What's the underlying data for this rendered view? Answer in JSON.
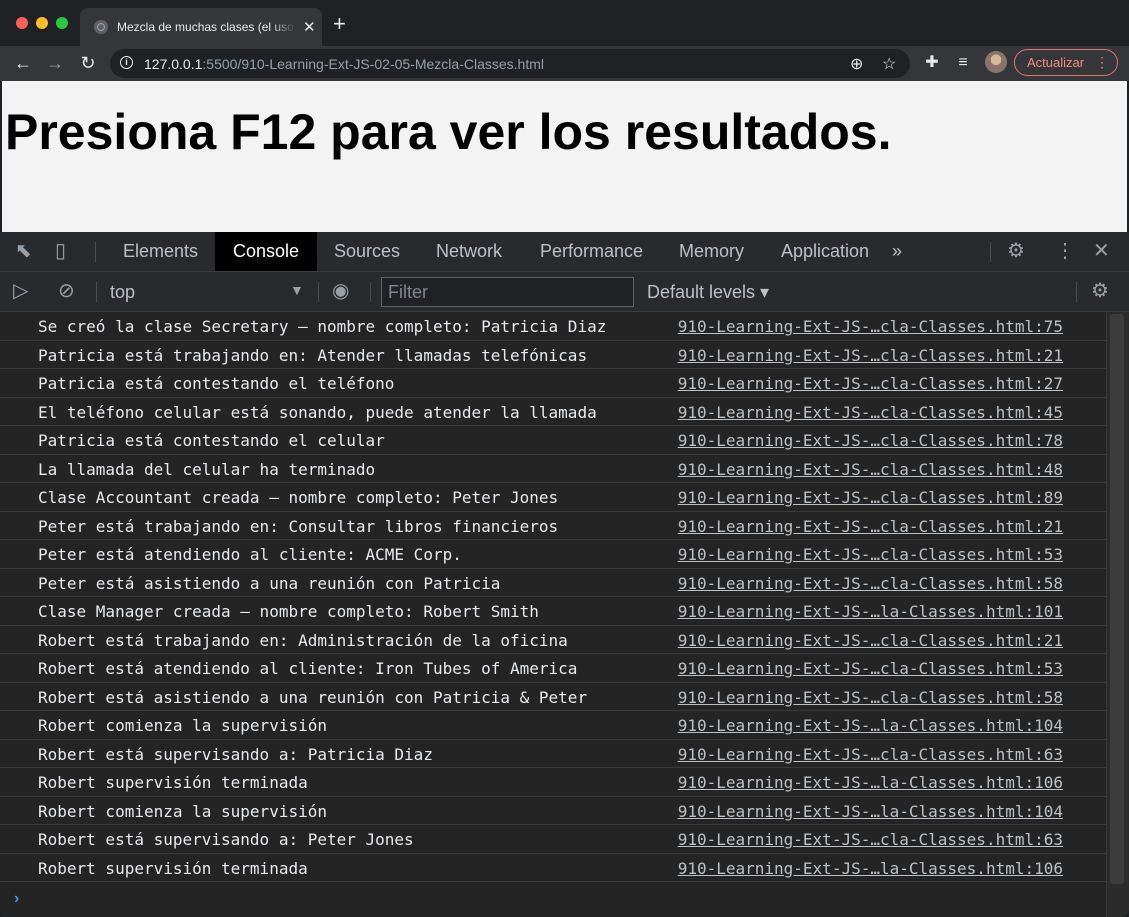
{
  "browser": {
    "tab_title": "Mezcla de muchas clases (el uso",
    "url_host": "127.0.0.1",
    "url_rest": ":5500/910-Learning-Ext-JS-02-05-Mezcla-Classes.html",
    "update_button": "Actualizar"
  },
  "page": {
    "heading": "Presiona F12 para ver los resultados."
  },
  "devtools": {
    "tabs": [
      "Elements",
      "Console",
      "Sources",
      "Network",
      "Performance",
      "Memory",
      "Application"
    ],
    "active_tab": "Console",
    "more_tabs": "»",
    "context": "top",
    "filter_placeholder": "Filter",
    "levels": "Default levels ▾"
  },
  "console_messages": [
    {
      "text": "Se creó la clase Secretary – nombre completo: Patricia Diaz",
      "source": "910-Learning-Ext-JS-…cla-Classes.html:75"
    },
    {
      "text": "Patricia está trabajando en: Atender llamadas telefónicas",
      "source": "910-Learning-Ext-JS-…cla-Classes.html:21"
    },
    {
      "text": "Patricia está contestando el teléfono",
      "source": "910-Learning-Ext-JS-…cla-Classes.html:27"
    },
    {
      "text": "El teléfono celular está sonando, puede atender la llamada",
      "source": "910-Learning-Ext-JS-…cla-Classes.html:45"
    },
    {
      "text": "Patricia está contestando el celular",
      "source": "910-Learning-Ext-JS-…cla-Classes.html:78"
    },
    {
      "text": "La llamada del celular ha terminado",
      "source": "910-Learning-Ext-JS-…cla-Classes.html:48"
    },
    {
      "text": "Clase Accountant creada – nombre completo: Peter Jones",
      "source": "910-Learning-Ext-JS-…cla-Classes.html:89"
    },
    {
      "text": "Peter está trabajando en: Consultar libros financieros",
      "source": "910-Learning-Ext-JS-…cla-Classes.html:21"
    },
    {
      "text": "Peter está atendiendo al cliente: ACME Corp.",
      "source": "910-Learning-Ext-JS-…cla-Classes.html:53"
    },
    {
      "text": "Peter está asistiendo a una reunión con Patricia",
      "source": "910-Learning-Ext-JS-…cla-Classes.html:58"
    },
    {
      "text": "Clase Manager creada – nombre completo: Robert Smith",
      "source": "910-Learning-Ext-JS-…la-Classes.html:101"
    },
    {
      "text": "Robert está trabajando en: Administración de la oficina",
      "source": "910-Learning-Ext-JS-…cla-Classes.html:21"
    },
    {
      "text": "Robert está atendiendo al cliente: Iron Tubes of America",
      "source": "910-Learning-Ext-JS-…cla-Classes.html:53"
    },
    {
      "text": "Robert está asistiendo a una reunión con Patricia & Peter",
      "source": "910-Learning-Ext-JS-…cla-Classes.html:58"
    },
    {
      "text": "Robert comienza la supervisión",
      "source": "910-Learning-Ext-JS-…la-Classes.html:104"
    },
    {
      "text": "Robert está supervisando a: Patricia Diaz",
      "source": "910-Learning-Ext-JS-…cla-Classes.html:63"
    },
    {
      "text": "Robert supervisión terminada",
      "source": "910-Learning-Ext-JS-…la-Classes.html:106"
    },
    {
      "text": "Robert comienza la supervisión",
      "source": "910-Learning-Ext-JS-…la-Classes.html:104"
    },
    {
      "text": "Robert está supervisando a: Peter Jones",
      "source": "910-Learning-Ext-JS-…cla-Classes.html:63"
    },
    {
      "text": "Robert supervisión terminada",
      "source": "910-Learning-Ext-JS-…la-Classes.html:106"
    }
  ]
}
